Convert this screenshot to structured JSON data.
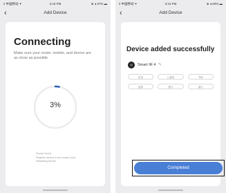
{
  "left_screen": {
    "status": {
      "carrier": "ıl 中国移动 ✦",
      "time": "3:43 PM",
      "battery": "⊕ ◂ 37% ▬"
    },
    "nav": {
      "back": "‹",
      "title": "Add Device"
    },
    "title": "Connecting",
    "subtitle": "Make sure your router, mobile, and device are as close as possible",
    "progress": {
      "label": "3%",
      "fraction": 0.03
    },
    "steps": [
      "Device found",
      "Register device to the smart cloud",
      "Initializing device"
    ],
    "accent_color": "#2c5fb4"
  },
  "right_screen": {
    "status": {
      "carrier": "ıl 中国移动 ✦",
      "time": "3:44 PM",
      "battery": "⊕ ◂ 60% ▬"
    },
    "nav": {
      "back": "‹",
      "title": "Add Device"
    },
    "title": "Device added successfully",
    "device": {
      "name": "Smart IR 4",
      "edit_icon": "✎"
    },
    "rooms": [
      "卧室",
      "儿童房",
      "书房",
      "厨房",
      "餐厅",
      "客厅"
    ],
    "button": {
      "label": "Completed",
      "color": "#4a7fd6"
    }
  }
}
